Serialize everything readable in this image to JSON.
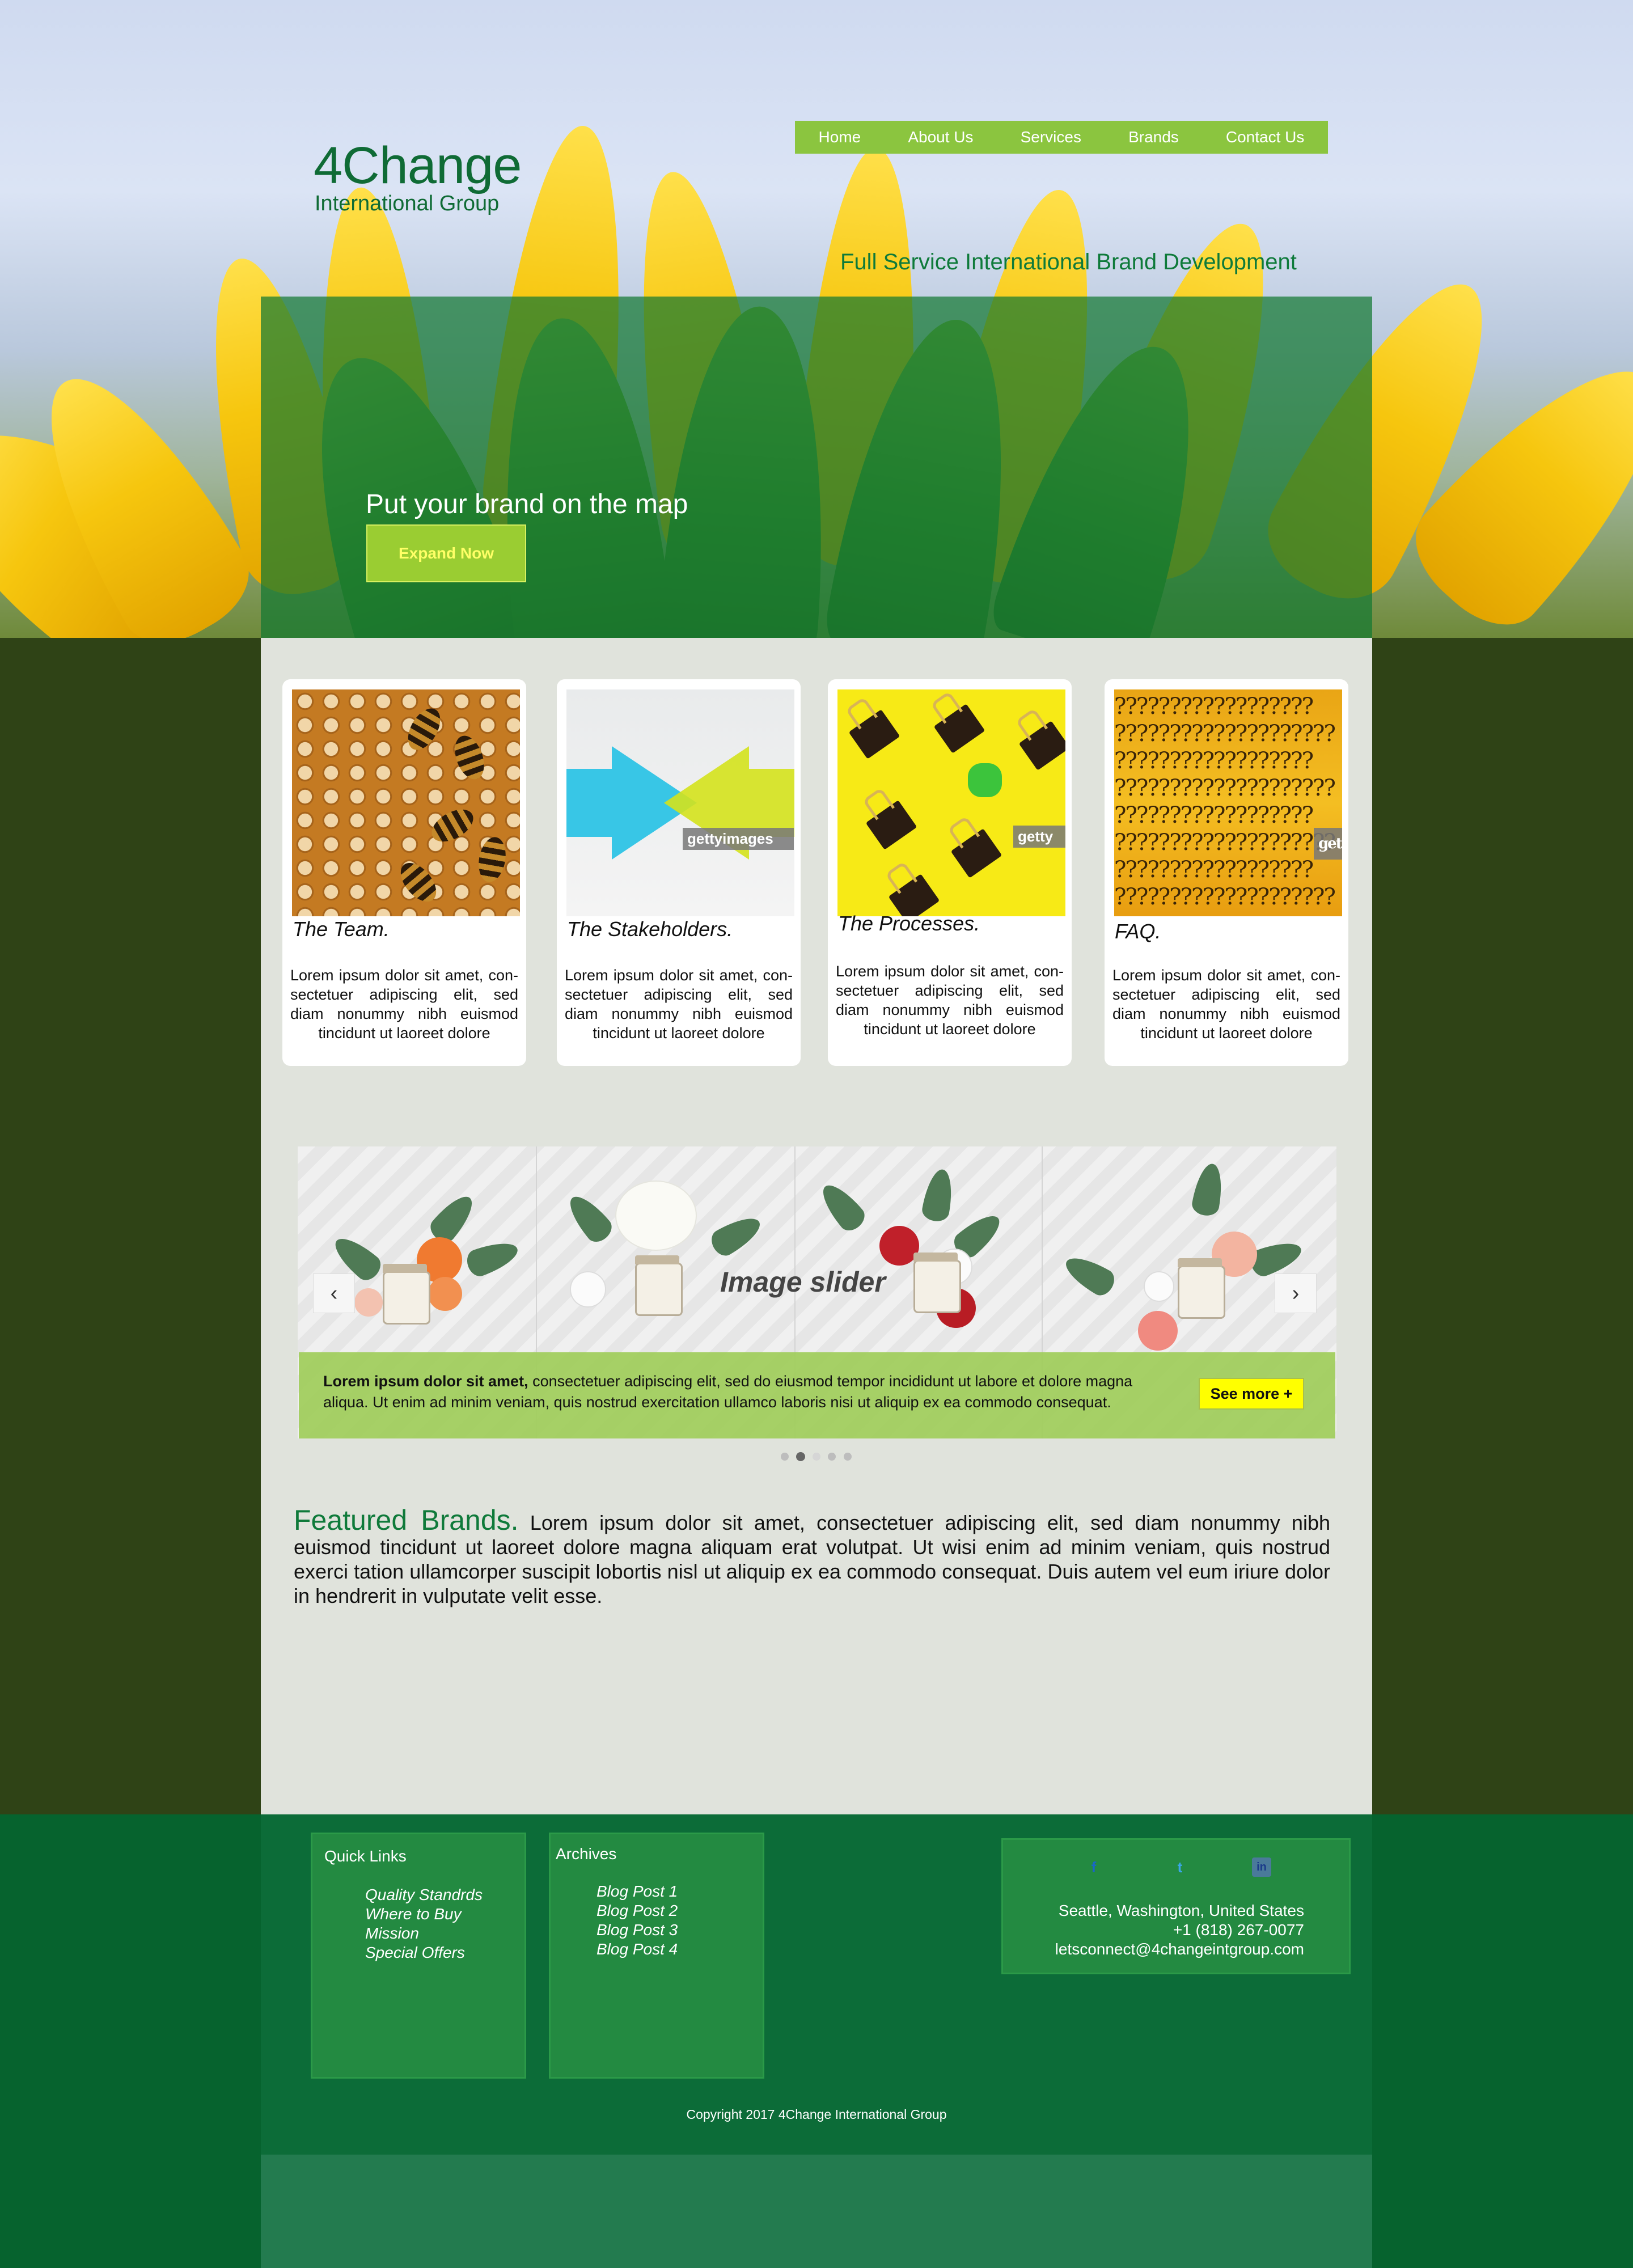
{
  "brand": {
    "name": "4Change",
    "subtitle": "International Group"
  },
  "nav": {
    "items": [
      "Home",
      "About Us",
      "Services",
      "Brands",
      "Contact Us"
    ]
  },
  "hero": {
    "tagline": "Full Service International Brand Development",
    "headline": "Put your brand on the map",
    "cta_label": "Expand Now"
  },
  "cards": [
    {
      "title": "The Team.",
      "text": "Lorem ipsum dolor sit amet, con-sectetuer adipiscing elit, sed diam nonummy nibh euismod tincidunt ut laoreet dolore",
      "image": "honeycomb-bees"
    },
    {
      "title": "The Stakeholders.",
      "text": "Lorem ipsum dolor sit amet, con-sectetuer adipiscing elit, sed diam nonummy nibh euismod tincidunt ut laoreet dolore",
      "image": "opposing-arrows",
      "watermark": "gettyimages"
    },
    {
      "title": "The Processes.",
      "text": "Lorem ipsum dolor sit amet, con-sectetuer adipiscing elit, sed diam nonummy nibh euismod tincidunt ut laoreet dolore",
      "image": "binder-clips",
      "watermark": "getty"
    },
    {
      "title": "FAQ.",
      "text": "Lorem ipsum dolor sit amet, con-sectetuer adipiscing elit, sed diam nonummy nibh euismod tincidunt ut laoreet dolore",
      "image": "question-marks",
      "watermark": "get"
    }
  ],
  "slider": {
    "title": "Image slider",
    "caption_bold": "Lorem ipsum dolor sit amet,",
    "caption_rest": " consectetuer adipiscing elit, sed do eiusmod tempor incididunt ut labore et dolore magna aliqua. Ut enim ad minim veniam, quis nostrud exercitation ullamco laboris nisi ut aliquip ex ea commodo consequat.",
    "see_more": "See more +",
    "prev_icon": "‹",
    "next_icon": "›",
    "dots": 5,
    "active_dot": 1
  },
  "featured": {
    "title": "Featured Brands.",
    "text": " Lorem ipsum dolor sit amet, consectetuer adipiscing elit, sed diam nonummy nibh euismod tincidunt ut laoreet dolore magna aliquam erat volutpat. Ut wisi enim ad minim veniam, quis nostrud exerci tation ullamcorper suscipit lobortis nisl ut aliquip ex ea commodo consequat. Duis autem vel eum iriure dolor in hendrerit in vulputate velit esse."
  },
  "footer": {
    "quick_links_title": "Quick Links",
    "quick_links": [
      "Quality Standrds",
      "Where to Buy",
      "Mission",
      "Special Offers"
    ],
    "archives_title": "Archives",
    "archives": [
      "Blog Post 1",
      "Blog Post 2",
      "Blog Post 3",
      "Blog Post 4"
    ],
    "social": [
      {
        "name": "facebook-icon",
        "glyph": "f",
        "color": "#1a66c8"
      },
      {
        "name": "twitter-icon",
        "glyph": "t",
        "color": "#3aa6e8"
      },
      {
        "name": "linkedin-icon",
        "glyph": "in",
        "color": "#1a3a8a"
      }
    ],
    "address": "Seattle, Washington, United States",
    "phone": "+1 (818) 267-0077",
    "email": "letsconnect@4changeintgroup.com",
    "copyright": "Copyright 2017 4Change International Group"
  },
  "colors": {
    "brand_green": "#0f6b35",
    "nav_green": "#8bc53f",
    "page_bg": "#2f4316",
    "content_bg": "#e0e3dc",
    "footer_bg": "#06632e",
    "cta_yellow": "#ffff00"
  }
}
